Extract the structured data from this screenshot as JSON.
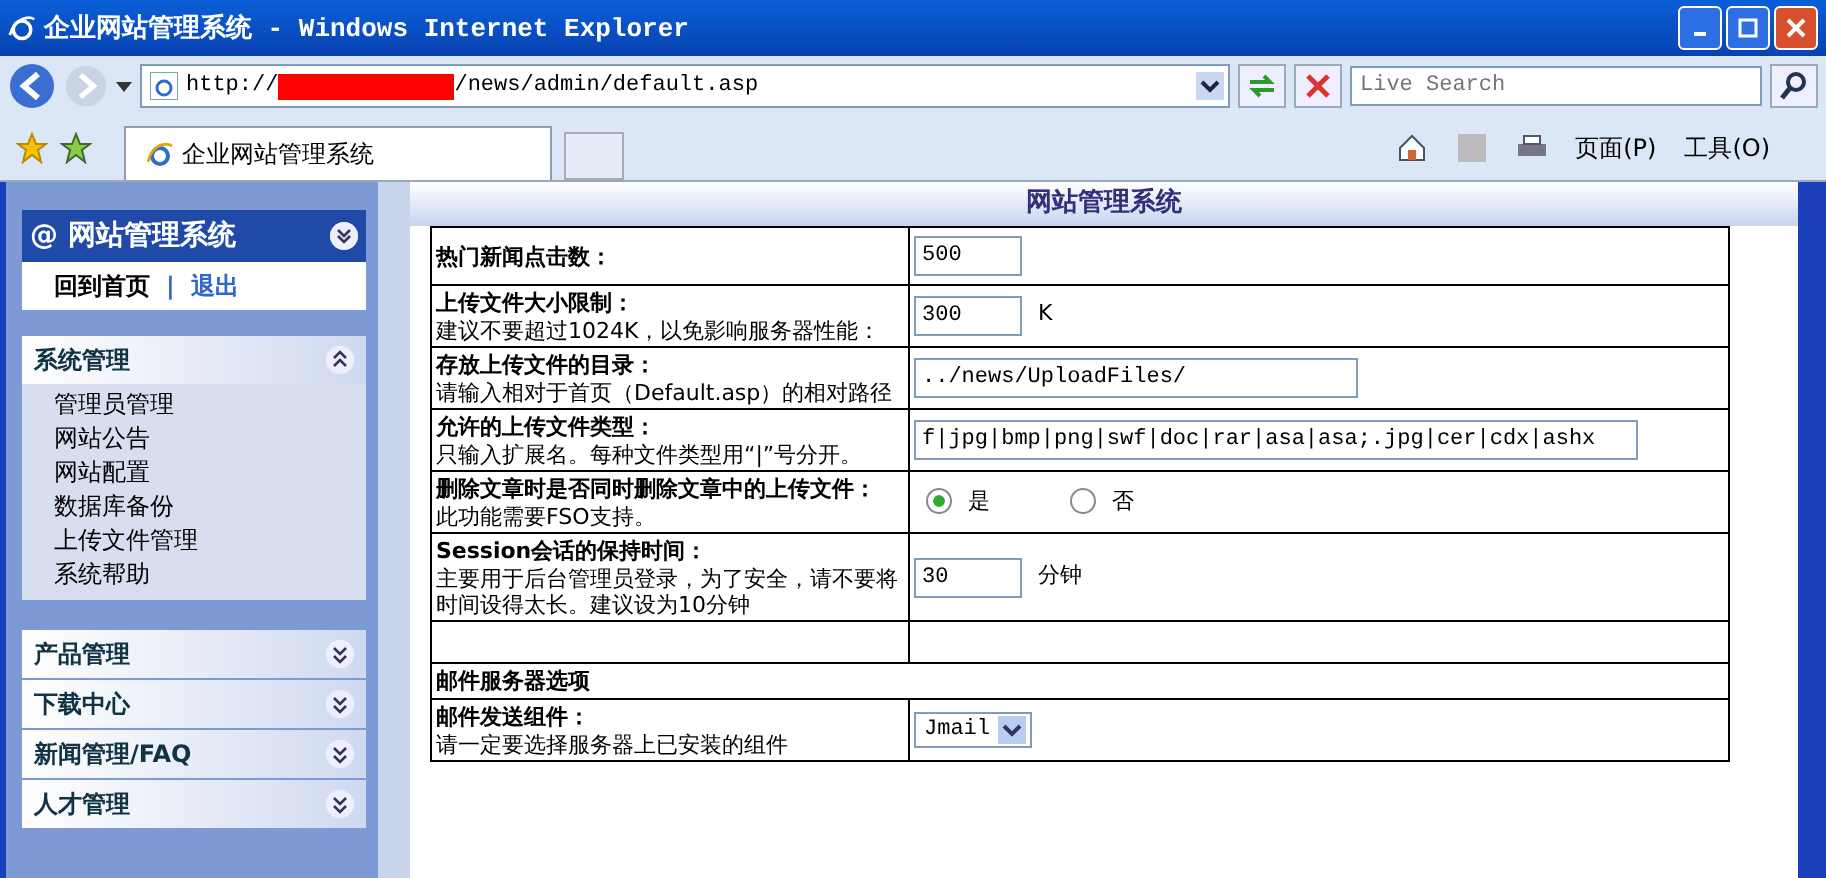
{
  "window": {
    "title": "企业网站管理系统 - Windows Internet Explorer"
  },
  "address": {
    "prefix": "http://",
    "suffix": "/news/admin/default.asp"
  },
  "search": {
    "placeholder": "Live Search"
  },
  "tab": {
    "title": "企业网站管理系统"
  },
  "toolbar": [
    "页面(P)",
    "工具(O)"
  ],
  "sidebar": {
    "badge": "@",
    "title": "网站管理系统",
    "links": [
      "回到首页",
      "退出"
    ],
    "separator": "|",
    "sections": [
      {
        "title": "系统管理",
        "expanded": true,
        "items": [
          "管理员管理",
          "网站公告",
          "网站配置",
          "数据库备份",
          "上传文件管理",
          "系统帮助"
        ]
      },
      {
        "title": "产品管理",
        "expanded": false
      },
      {
        "title": "下载中心",
        "expanded": false
      },
      {
        "title": "新闻管理/FAQ",
        "expanded": false
      },
      {
        "title": "人才管理",
        "expanded": false
      }
    ]
  },
  "header": "网站管理系统",
  "rows": [
    {
      "kind": "input",
      "label": "热门新闻点击数：",
      "value": "500"
    },
    {
      "kind": "input",
      "label": "上传文件大小限制：",
      "hint": "建议不要超过1024K，以免影响服务器性能：",
      "value": "300",
      "unit": "K"
    },
    {
      "kind": "input",
      "label": "存放上传文件的目录：",
      "hint": "请输入相对于首页（Default.asp）的相对路径",
      "value": "../news/UploadFiles/"
    },
    {
      "kind": "input",
      "label": "允许的上传文件类型：",
      "hint": "只输入扩展名。每种文件类型用“|”号分开。",
      "value": "f|jpg|bmp|png|swf|doc|rar|asa|asa;.jpg|cer|cdx|ashx"
    },
    {
      "kind": "radio",
      "label": "删除文章时是否同时删除文章中的上传文件：",
      "hint": "此功能需要FSO支持。",
      "options": [
        {
          "label": "是",
          "selected": true
        },
        {
          "label": "否",
          "selected": false
        }
      ]
    },
    {
      "kind": "input",
      "label": "Session会话的保持时间：",
      "hint": "主要用于后台管理员登录，为了安全，请不要将时间设得太长。建议设为10分钟",
      "value": "30",
      "unit": "分钟"
    },
    {
      "kind": "blank"
    },
    {
      "kind": "section",
      "label": "邮件服务器选项"
    },
    {
      "kind": "select",
      "label": "邮件发送组件：",
      "hint": "请一定要选择服务器上已安装的组件",
      "value": "Jmail"
    }
  ]
}
